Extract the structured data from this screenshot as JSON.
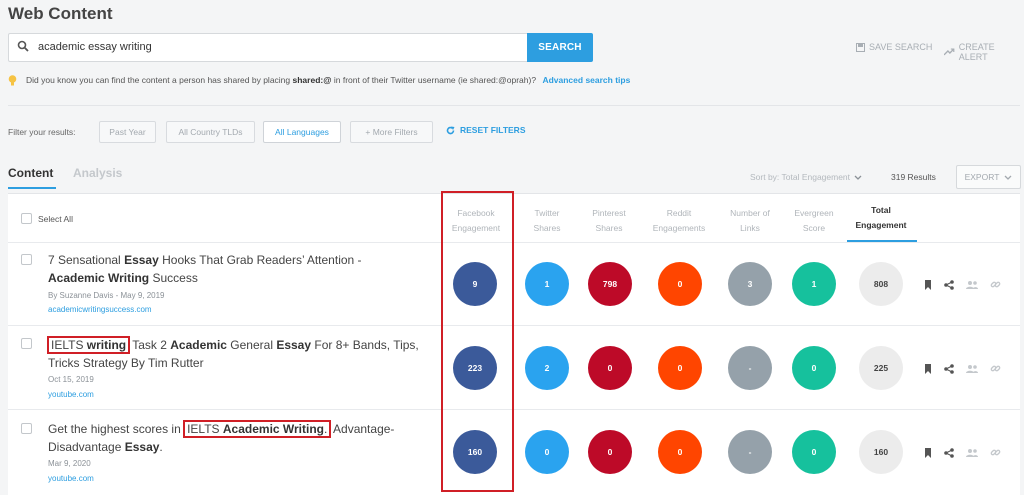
{
  "page_title": "Web Content",
  "search": {
    "query": "academic essay writing",
    "button_label": "SEARCH",
    "save_label": "SAVE SEARCH",
    "alert_label": "CREATE ALERT"
  },
  "tip": {
    "text_before": "Did you know you can find the content a person has shared by placing",
    "keyword": "shared:@",
    "text_after": "in front of their Twitter username (ie shared:@oprah)?",
    "link": "Advanced search tips"
  },
  "filters": {
    "label": "Filter your results:",
    "past_year": "Past Year",
    "country": "All Country TLDs",
    "languages": "All Languages",
    "more": "+ More Filters",
    "reset": "RESET FILTERS"
  },
  "tabs": {
    "content": "Content",
    "analysis": "Analysis"
  },
  "toolbar": {
    "sort_label": "Sort by: Total Engagement",
    "results": "319 Results",
    "export": "EXPORT"
  },
  "table": {
    "select_all": "Select All",
    "columns": {
      "fb": [
        "Facebook",
        "Engagement"
      ],
      "tw": [
        "Twitter",
        "Shares"
      ],
      "pin": [
        "Pinterest",
        "Shares"
      ],
      "reddit": [
        "Reddit",
        "Engagements"
      ],
      "links": [
        "Number of",
        "Links"
      ],
      "ever": [
        "Evergreen",
        "Score"
      ],
      "total": [
        "Total",
        "Engagement"
      ]
    }
  },
  "articles": [
    {
      "title": {
        "t1": "7 Sensational ",
        "t2": "Essay",
        "t3": " Hooks That Grab Readers’ Attention -",
        "t4": "Academic Writing",
        "t5": " Success"
      },
      "meta": "By Suzanne Davis - May 9, 2019",
      "domain": "academicwritingsuccess.com",
      "fb": "9",
      "tw": "1",
      "pin": "798",
      "reddit": "0",
      "links": "3",
      "ever": "1",
      "total": "808"
    },
    {
      "title": {
        "t1": "IELTS ",
        "t2": "writing",
        "t3": " Task 2 ",
        "t4": "Academic",
        "t5": " General ",
        "t6": "Essay",
        "t7": " For 8+ Bands, Tips,",
        "t8": "Tricks Strategy By Tim Rutter"
      },
      "meta": "Oct 15, 2019",
      "domain": "youtube.com",
      "fb": "223",
      "tw": "2",
      "pin": "0",
      "reddit": "0",
      "links": "-",
      "ever": "0",
      "total": "225"
    },
    {
      "title": {
        "t1": "Get the highest scores in ",
        "t2": "IELTS ",
        "t3": "Academic Writing",
        "t4": ".",
        "t5": " Advantage-",
        "t6": "Disadvantage ",
        "t7": "Essay",
        "t8": "."
      },
      "meta": "Mar 9, 2020",
      "domain": "youtube.com",
      "fb": "160",
      "tw": "0",
      "pin": "0",
      "reddit": "0",
      "links": "-",
      "ever": "0",
      "total": "160"
    }
  ],
  "colors": {
    "accent": "#2d9ee0",
    "facebook": "#3b5a9a",
    "twitter": "#2aa3ef",
    "pinterest": "#bd0a28",
    "reddit": "#ff4500",
    "links": "#95a1aa",
    "evergreen": "#16c19d",
    "highlight": "#d01f26"
  },
  "icons": [
    "search-icon",
    "lightbulb-icon",
    "save-icon",
    "trend-icon",
    "refresh-icon",
    "chevron-down-icon",
    "bookmark-icon",
    "share-icon",
    "users-icon",
    "link-icon"
  ]
}
